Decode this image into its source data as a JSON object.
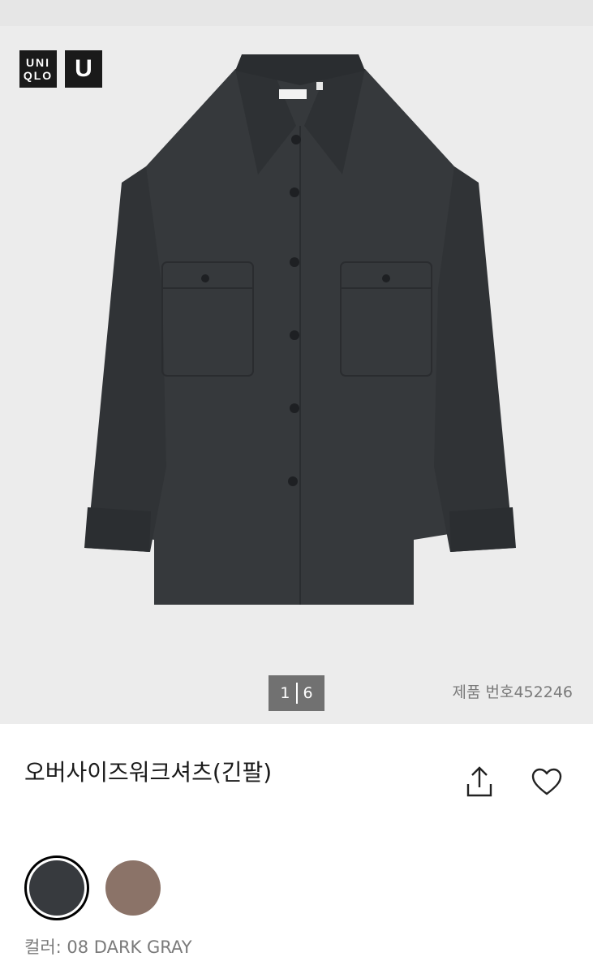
{
  "brand": {
    "logo_line1": "UNI",
    "logo_line2": "QLO",
    "sub_logo": "U"
  },
  "gallery": {
    "current": "1",
    "total": "6",
    "product_number": "제품 번호452246",
    "image_icon": "shirt-image"
  },
  "product": {
    "name": "오버사이즈워크셔츠(긴팔)",
    "share_icon": "share-icon",
    "favorite_icon": "heart-icon"
  },
  "colors": {
    "swatches": [
      {
        "name": "DARK GRAY",
        "hex": "#373a3e",
        "selected": true
      },
      {
        "name": "BROWN",
        "hex": "#8b7368",
        "selected": false
      }
    ],
    "label": "컬러: 08 DARK GRAY"
  }
}
